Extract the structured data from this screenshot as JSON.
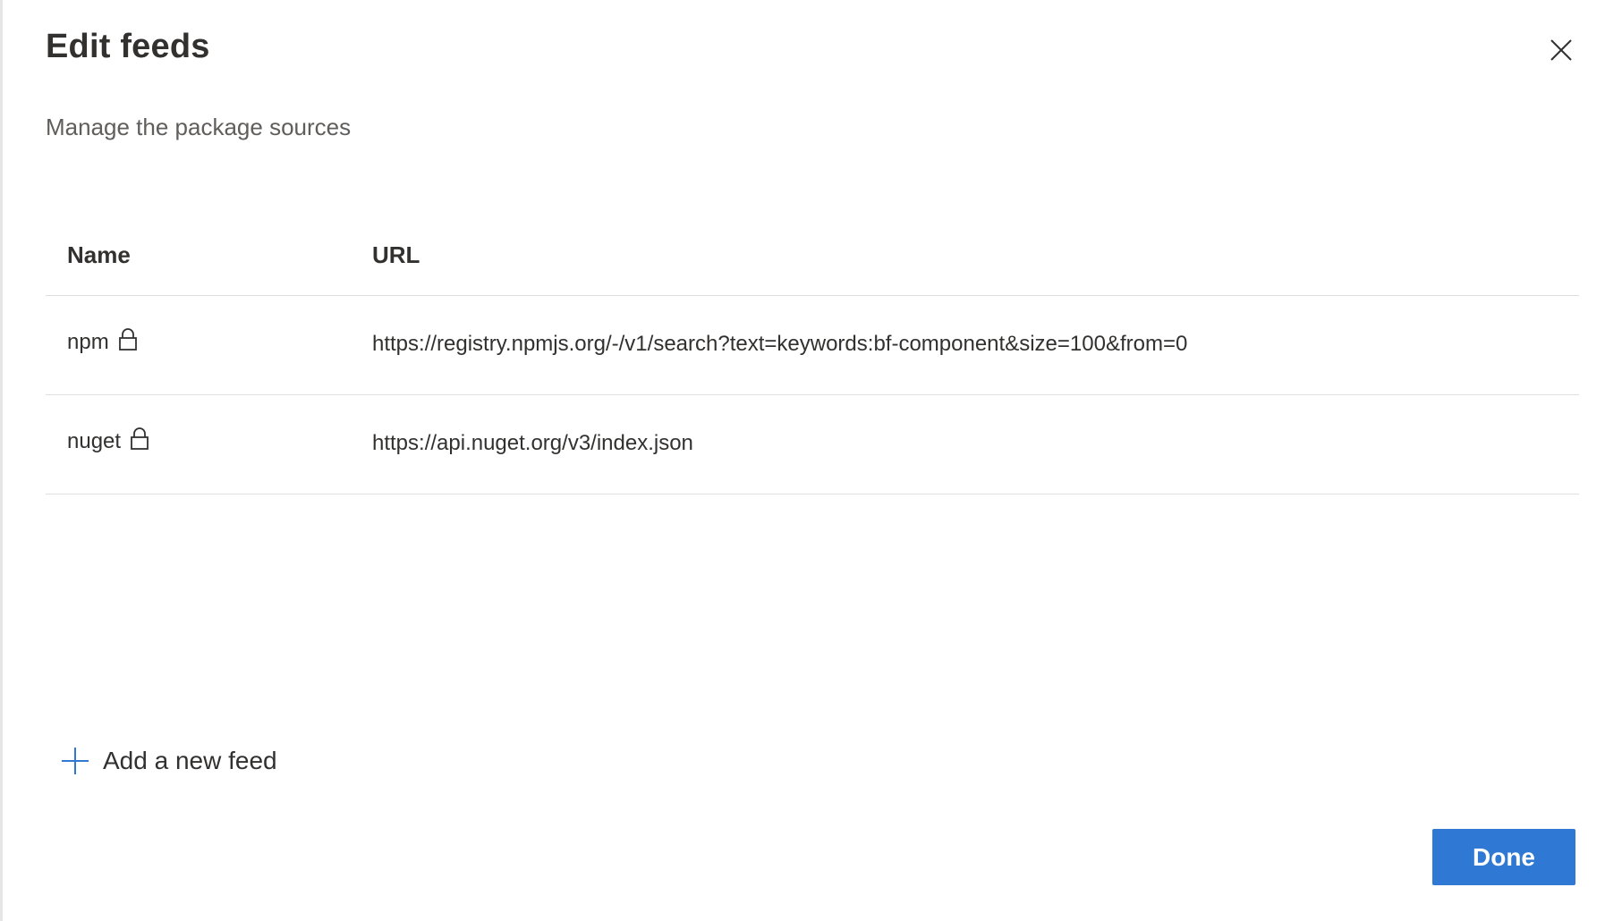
{
  "dialog": {
    "title": "Edit feeds",
    "subtitle": "Manage the package sources",
    "close_icon": "close-icon"
  },
  "table": {
    "columns": [
      "Name",
      "URL"
    ],
    "rows": [
      {
        "name": "npm",
        "locked": true,
        "url": "https://registry.npmjs.org/-/v1/search?text=keywords:bf-component&size=100&from=0"
      },
      {
        "name": "nuget",
        "locked": true,
        "url": "https://api.nuget.org/v3/index.json"
      }
    ]
  },
  "actions": {
    "add_feed_label": "Add a new feed",
    "done_label": "Done"
  },
  "colors": {
    "accent": "#2f78d4",
    "text": "#323130",
    "subtle_text": "#605e5c",
    "divider": "#e1dfdd"
  }
}
